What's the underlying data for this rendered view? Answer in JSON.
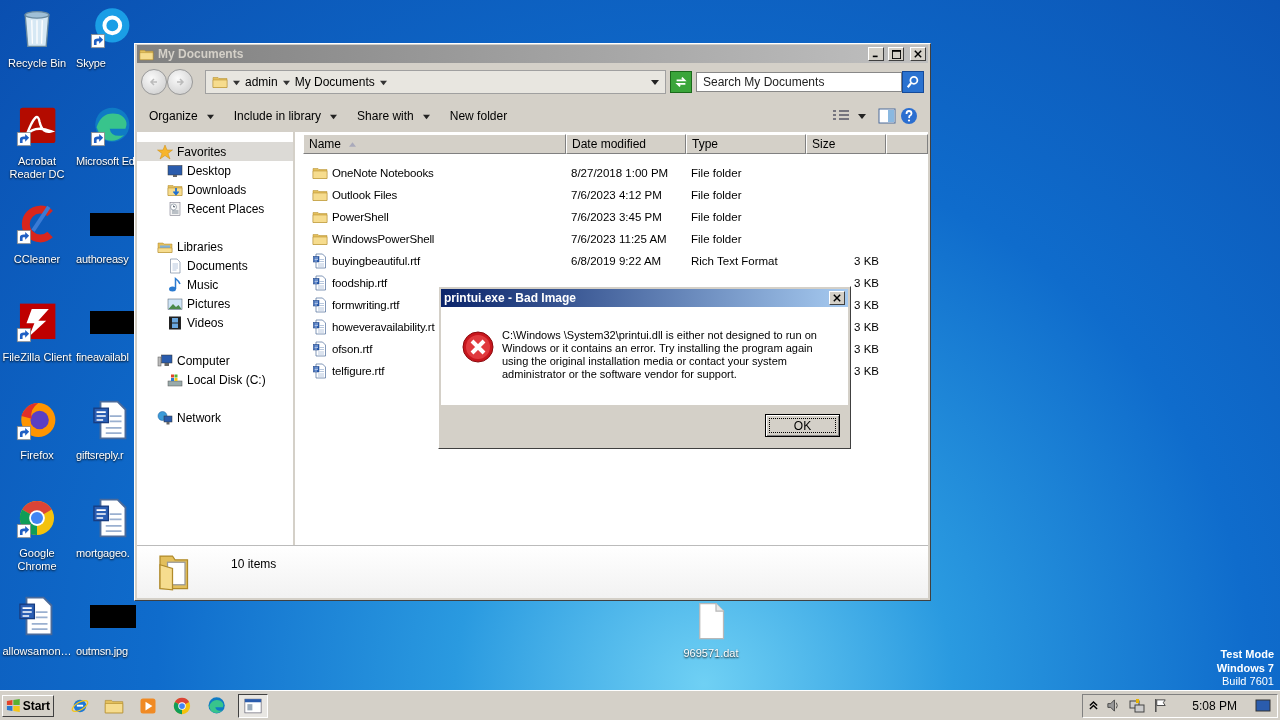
{
  "desktop": {
    "icons": [
      [
        {
          "label": "Recycle Bin",
          "kind": "recycle",
          "shortcut": false
        },
        {
          "label": "Acrobat Reader DC",
          "kind": "acrobat",
          "shortcut": true
        },
        {
          "label": "CCleaner",
          "kind": "ccleaner",
          "shortcut": true
        },
        {
          "label": "FileZilla Client",
          "kind": "filezilla",
          "shortcut": true
        },
        {
          "label": "Firefox",
          "kind": "firefox",
          "shortcut": true
        },
        {
          "label": "Google Chrome",
          "kind": "chrome",
          "shortcut": true
        },
        {
          "label": "allowsamon…",
          "kind": "word",
          "shortcut": false
        }
      ],
      [
        {
          "label": "Skype",
          "kind": "skype",
          "shortcut": true
        },
        {
          "label": "Microsoft Ed",
          "kind": "edge",
          "shortcut": true
        },
        {
          "label": "authoreasy",
          "kind": "redacted",
          "shortcut": false
        },
        {
          "label": "fineavailabl",
          "kind": "redacted",
          "shortcut": false
        },
        {
          "label": "giftsreply.r",
          "kind": "word",
          "shortcut": false
        },
        {
          "label": "mortgageo.",
          "kind": "word",
          "shortcut": false
        },
        {
          "label": "outmsn.jpg",
          "kind": "redacted",
          "shortcut": false
        }
      ]
    ],
    "files": [
      {
        "label": "969571.dat",
        "kind": "file"
      }
    ],
    "watermark": [
      {
        "text": "Test Mode",
        "bold": true
      },
      {
        "text": "Windows 7",
        "bold": true
      },
      {
        "text": "Build 7601",
        "bold": false
      }
    ]
  },
  "explorer": {
    "title": "My Documents",
    "breadcrumb": [
      "admin",
      "My Documents"
    ],
    "search": {
      "placeholder": "Search My Documents"
    },
    "toolbar": [
      {
        "label": "Organize",
        "menu": true
      },
      {
        "label": "Include in library",
        "menu": true
      },
      {
        "label": "Share with",
        "menu": true
      },
      {
        "label": "New folder",
        "menu": false
      }
    ],
    "nav": [
      {
        "label": "Favorites",
        "kind": "star",
        "selected": true,
        "children": [
          {
            "label": "Desktop",
            "kind": "desktop",
            "selected": false
          },
          {
            "label": "Downloads",
            "kind": "downloads",
            "selected": false
          },
          {
            "label": "Recent Places",
            "kind": "recent",
            "selected": false
          }
        ]
      },
      {
        "label": "Libraries",
        "kind": "library",
        "selected": false,
        "children": [
          {
            "label": "Documents",
            "kind": "docs",
            "selected": false
          },
          {
            "label": "Music",
            "kind": "music",
            "selected": false
          },
          {
            "label": "Pictures",
            "kind": "pictures",
            "selected": false
          },
          {
            "label": "Videos",
            "kind": "videos",
            "selected": false
          }
        ]
      },
      {
        "label": "Computer",
        "kind": "computer",
        "selected": false,
        "children": [
          {
            "label": "Local Disk (C:)",
            "kind": "disk",
            "selected": false
          }
        ]
      },
      {
        "label": "Network",
        "kind": "network",
        "selected": false
      }
    ],
    "columns": [
      {
        "label": "Name",
        "sorted": true
      },
      {
        "label": "Date modified",
        "sorted": false
      },
      {
        "label": "Type",
        "sorted": false
      },
      {
        "label": "Size",
        "sorted": false
      }
    ],
    "rows": [
      {
        "name": "OneNote Notebooks",
        "kind": "folder",
        "date": "8/27/2018 1:00 PM",
        "type": "File folder"
      },
      {
        "name": "Outlook Files",
        "kind": "folder",
        "date": "7/6/2023 4:12 PM",
        "type": "File folder"
      },
      {
        "name": "PowerShell",
        "kind": "folder",
        "date": "7/6/2023 3:45 PM",
        "type": "File folder"
      },
      {
        "name": "WindowsPowerShell",
        "kind": "folder",
        "date": "7/6/2023 11:25 AM",
        "type": "File folder"
      },
      {
        "name": "buyingbeautiful.rtf",
        "kind": "doc",
        "date": "6/8/2019 9:22 AM",
        "type": "Rich Text Format",
        "size": "3 KB"
      },
      {
        "name": "foodship.rtf",
        "kind": "doc",
        "size": "3 KB"
      },
      {
        "name": "formwriting.rtf",
        "kind": "doc",
        "size": "3 KB"
      },
      {
        "name": "howeveravailability.rt",
        "kind": "doc",
        "size": "3 KB"
      },
      {
        "name": "ofson.rtf",
        "kind": "doc",
        "size": "3 KB"
      },
      {
        "name": "telfigure.rtf",
        "kind": "doc",
        "size": "3 KB"
      }
    ],
    "status": "10 items"
  },
  "dialog": {
    "title": "printui.exe - Bad Image",
    "message": "C:\\Windows \\System32\\printui.dll is either not designed to run on Windows or it contains an error. Try installing the program again using the original installation media or contact your system administrator or the software vendor for support.",
    "button": "OK"
  },
  "taskbar": {
    "start": "Start",
    "apps": [
      {
        "kind": "ie",
        "selected": false
      },
      {
        "kind": "explorer",
        "selected": false
      },
      {
        "kind": "media",
        "selected": false
      },
      {
        "kind": "chrome",
        "selected": false
      },
      {
        "kind": "edge",
        "selected": false
      },
      {
        "kind": "window",
        "selected": true
      }
    ],
    "clock": "5:08 PM"
  }
}
